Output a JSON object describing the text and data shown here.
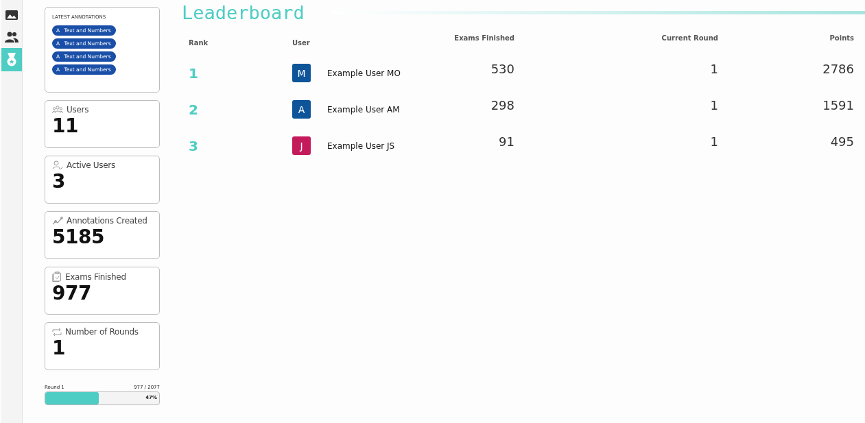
{
  "nav": [
    {
      "kind": "image",
      "selected": false
    },
    {
      "kind": "users",
      "selected": false
    },
    {
      "kind": "medal",
      "selected": true
    }
  ],
  "latest_annotations": {
    "title": "LATEST ANNOTATIONS",
    "items": [
      {
        "badge": "A",
        "label": "Text and Numbers"
      },
      {
        "badge": "A",
        "label": "Text and Numbers"
      },
      {
        "badge": "A",
        "label": "Text and Numbers"
      },
      {
        "badge": "A",
        "label": "Text and Numbers"
      }
    ]
  },
  "stats": [
    {
      "kind": "users",
      "label": "Users",
      "value": "11"
    },
    {
      "kind": "active",
      "label": "Active Users",
      "value": "3"
    },
    {
      "kind": "annotations",
      "label": "Annotations Created",
      "value": "5185"
    },
    {
      "kind": "exams",
      "label": "Exams Finished",
      "value": "977"
    },
    {
      "kind": "rounds",
      "label": "Number of Rounds",
      "value": "1"
    }
  ],
  "round_progress": {
    "label": "Round 1",
    "count": "977 / 2077",
    "percent": "47%",
    "level": 0.47
  },
  "title": "Leaderboard",
  "table": {
    "columns": [
      "Rank",
      "User",
      "Exams Finished",
      "Current Round",
      "Points"
    ],
    "rows": [
      {
        "rank": "1",
        "initial": "M",
        "color": "#0d5499",
        "name": "Example User MO",
        "exams": "530",
        "round": "1",
        "points": "2786"
      },
      {
        "rank": "2",
        "initial": "A",
        "color": "#0d5499",
        "name": "Example User AM",
        "exams": "298",
        "round": "1",
        "points": "1591"
      },
      {
        "rank": "3",
        "initial": "J",
        "color": "#c41a5b",
        "name": "Example User JS",
        "exams": "91",
        "round": "1",
        "points": "495"
      }
    ]
  }
}
